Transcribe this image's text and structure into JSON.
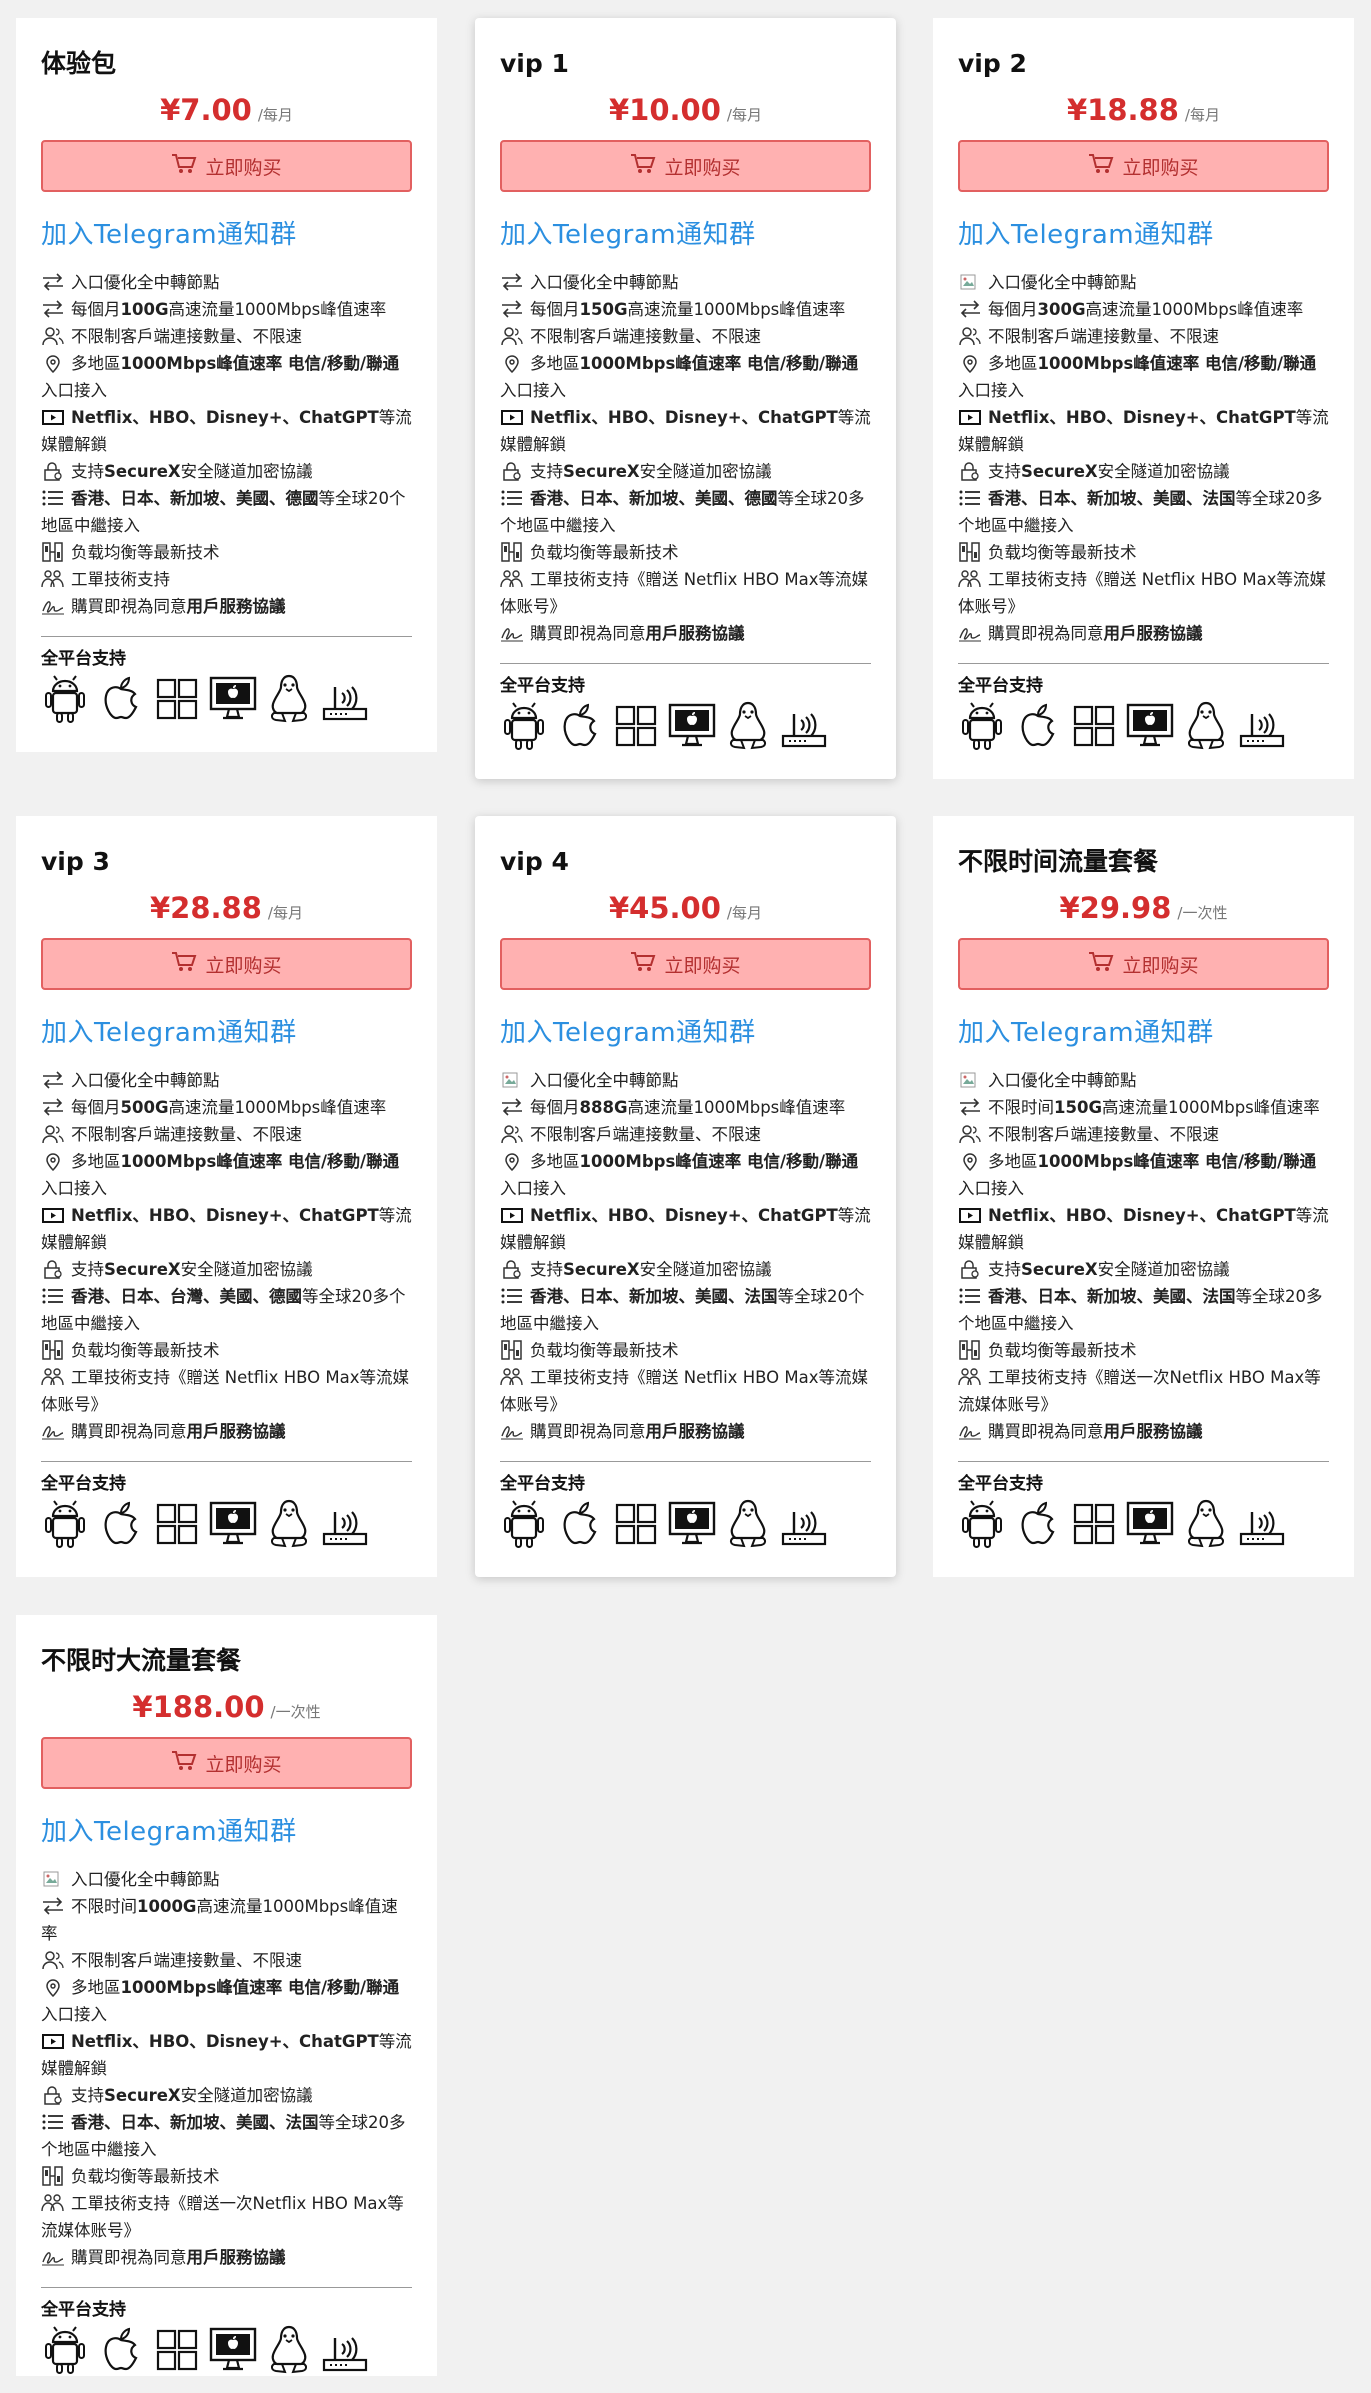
{
  "common": {
    "buy_label": "立即购买",
    "telegram_label": "加入Telegram通知群",
    "platform_title": "全平台支持",
    "platform_icons": [
      "android-icon",
      "apple-icon",
      "windows-icon",
      "mac-desktop-icon",
      "linux-icon",
      "router-icon"
    ]
  },
  "colors": {
    "price": "#d42e2e",
    "button_bg": "#ffb1b1",
    "button_border": "#e26060",
    "telegram_link": "#2b8fe0"
  },
  "plans": [
    {
      "title": "体验包",
      "price": "¥7.00",
      "period": "/每月",
      "features": [
        {
          "icon": "switch-icon",
          "parts": [
            {
              "t": "入口優化全中轉節點"
            }
          ]
        },
        {
          "icon": "switch-icon",
          "parts": [
            {
              "t": "每個月"
            },
            {
              "t": "100G",
              "b": true
            },
            {
              "t": "高速流量1000Mbps峰值速率"
            }
          ]
        },
        {
          "icon": "users-icon",
          "parts": [
            {
              "t": "不限制客戶端連接數量、不限速"
            }
          ]
        },
        {
          "icon": "location-icon",
          "parts": [
            {
              "t": "多地區"
            },
            {
              "t": "1000Mbps峰值速率 电信/移動/聯通",
              "b": true
            },
            {
              "t": "入口接入"
            }
          ]
        },
        {
          "icon": "video-icon",
          "parts": [
            {
              "t": "Netflix、HBO、Disney+、ChatGPT",
              "b": true
            },
            {
              "t": "等流媒體解鎖"
            }
          ]
        },
        {
          "icon": "lock-icon",
          "parts": [
            {
              "t": "支持"
            },
            {
              "t": "SecureX",
              "b": true
            },
            {
              "t": "安全隧道加密協議"
            }
          ]
        },
        {
          "icon": "list-icon",
          "parts": [
            {
              "t": "香港、日本、新加坡、美國、德國",
              "b": true
            },
            {
              "t": "等全球20个地區中繼接入"
            }
          ]
        },
        {
          "icon": "balance-icon",
          "parts": [
            {
              "t": "负载均衡等最新技术"
            }
          ]
        },
        {
          "icon": "support-icon",
          "parts": [
            {
              "t": "工單技術支持"
            }
          ]
        },
        {
          "icon": "sign-icon",
          "parts": [
            {
              "t": "購買即視為同意"
            },
            {
              "t": "用戶服務協議",
              "b": true
            }
          ]
        }
      ]
    },
    {
      "title": "vip 1",
      "price": "¥10.00",
      "period": "/每月",
      "features": [
        {
          "icon": "switch-icon",
          "parts": [
            {
              "t": "入口優化全中轉節點"
            }
          ]
        },
        {
          "icon": "switch-icon",
          "parts": [
            {
              "t": "每個月"
            },
            {
              "t": "150G",
              "b": true
            },
            {
              "t": "高速流量1000Mbps峰值速率"
            }
          ]
        },
        {
          "icon": "users-icon",
          "parts": [
            {
              "t": "不限制客戶端連接數量、不限速"
            }
          ]
        },
        {
          "icon": "location-icon",
          "parts": [
            {
              "t": "多地區"
            },
            {
              "t": "1000Mbps峰值速率 电信/移動/聯通",
              "b": true
            },
            {
              "t": "入口接入"
            }
          ]
        },
        {
          "icon": "video-icon",
          "parts": [
            {
              "t": "Netflix、HBO、Disney+、ChatGPT",
              "b": true
            },
            {
              "t": "等流媒體解鎖"
            }
          ]
        },
        {
          "icon": "lock-icon",
          "parts": [
            {
              "t": "支持"
            },
            {
              "t": "SecureX",
              "b": true
            },
            {
              "t": "安全隧道加密協議"
            }
          ]
        },
        {
          "icon": "list-icon",
          "parts": [
            {
              "t": "香港、日本、新加坡、美國、德國",
              "b": true
            },
            {
              "t": "等全球20多个地區中繼接入"
            }
          ]
        },
        {
          "icon": "balance-icon",
          "parts": [
            {
              "t": "负载均衡等最新技术"
            }
          ]
        },
        {
          "icon": "support-icon",
          "parts": [
            {
              "t": "工單技術支持《贈送 Netflix HBO Max等流媒体账号》"
            }
          ]
        },
        {
          "icon": "sign-icon",
          "parts": [
            {
              "t": "購買即視為同意"
            },
            {
              "t": "用戶服務協議",
              "b": true
            }
          ]
        }
      ]
    },
    {
      "title": "vip 2",
      "price": "¥18.88",
      "period": "/每月",
      "features": [
        {
          "icon": "broken-image-icon",
          "parts": [
            {
              "t": "入口優化全中轉節點"
            }
          ]
        },
        {
          "icon": "switch-icon",
          "parts": [
            {
              "t": "每個月"
            },
            {
              "t": "300G",
              "b": true
            },
            {
              "t": "高速流量1000Mbps峰值速率"
            }
          ]
        },
        {
          "icon": "users-icon",
          "parts": [
            {
              "t": "不限制客戶端連接數量、不限速"
            }
          ]
        },
        {
          "icon": "location-icon",
          "parts": [
            {
              "t": "多地區"
            },
            {
              "t": "1000Mbps峰值速率 电信/移動/聯通",
              "b": true
            },
            {
              "t": "入口接入"
            }
          ]
        },
        {
          "icon": "video-icon",
          "parts": [
            {
              "t": "Netflix、HBO、Disney+、ChatGPT",
              "b": true
            },
            {
              "t": "等流媒體解鎖"
            }
          ]
        },
        {
          "icon": "lock-icon",
          "parts": [
            {
              "t": "支持"
            },
            {
              "t": "SecureX",
              "b": true
            },
            {
              "t": "安全隧道加密協議"
            }
          ]
        },
        {
          "icon": "list-icon",
          "parts": [
            {
              "t": "香港、日本、新加坡、美國、法国",
              "b": true
            },
            {
              "t": "等全球20多个地區中繼接入"
            }
          ]
        },
        {
          "icon": "balance-icon",
          "parts": [
            {
              "t": "负载均衡等最新技术"
            }
          ]
        },
        {
          "icon": "support-icon",
          "parts": [
            {
              "t": "工單技術支持《贈送 Netflix HBO Max等流媒体账号》"
            }
          ]
        },
        {
          "icon": "sign-icon",
          "parts": [
            {
              "t": "購買即視為同意"
            },
            {
              "t": "用戶服務協議",
              "b": true
            }
          ]
        }
      ]
    },
    {
      "title": "vip 3",
      "price": "¥28.88",
      "period": "/每月",
      "features": [
        {
          "icon": "switch-icon",
          "parts": [
            {
              "t": "入口優化全中轉節點"
            }
          ]
        },
        {
          "icon": "switch-icon",
          "parts": [
            {
              "t": "每個月"
            },
            {
              "t": "500G",
              "b": true
            },
            {
              "t": "高速流量1000Mbps峰值速率"
            }
          ]
        },
        {
          "icon": "users-icon",
          "parts": [
            {
              "t": "不限制客戶端連接數量、不限速"
            }
          ]
        },
        {
          "icon": "location-icon",
          "parts": [
            {
              "t": "多地區"
            },
            {
              "t": "1000Mbps峰值速率 电信/移動/聯通",
              "b": true
            },
            {
              "t": "入口接入"
            }
          ]
        },
        {
          "icon": "video-icon",
          "parts": [
            {
              "t": "Netflix、HBO、Disney+、ChatGPT",
              "b": true
            },
            {
              "t": "等流媒體解鎖"
            }
          ]
        },
        {
          "icon": "lock-icon",
          "parts": [
            {
              "t": "支持"
            },
            {
              "t": "SecureX",
              "b": true
            },
            {
              "t": "安全隧道加密協議"
            }
          ]
        },
        {
          "icon": "list-icon",
          "parts": [
            {
              "t": "香港、日本、台灣、美國、德國",
              "b": true
            },
            {
              "t": "等全球20多个地區中繼接入"
            }
          ]
        },
        {
          "icon": "balance-icon",
          "parts": [
            {
              "t": "负载均衡等最新技术"
            }
          ]
        },
        {
          "icon": "support-icon",
          "parts": [
            {
              "t": "工單技術支持《贈送 Netflix HBO Max等流媒体账号》"
            }
          ]
        },
        {
          "icon": "sign-icon",
          "parts": [
            {
              "t": "購買即視為同意"
            },
            {
              "t": "用戶服務協議",
              "b": true
            }
          ]
        }
      ]
    },
    {
      "title": "vip 4",
      "price": "¥45.00",
      "period": "/每月",
      "features": [
        {
          "icon": "broken-image-icon",
          "parts": [
            {
              "t": "入口優化全中轉節點"
            }
          ]
        },
        {
          "icon": "switch-icon",
          "parts": [
            {
              "t": "每個月"
            },
            {
              "t": "888G",
              "b": true
            },
            {
              "t": "高速流量1000Mbps峰值速率"
            }
          ]
        },
        {
          "icon": "users-icon",
          "parts": [
            {
              "t": "不限制客戶端連接數量、不限速"
            }
          ]
        },
        {
          "icon": "location-icon",
          "parts": [
            {
              "t": "多地區"
            },
            {
              "t": "1000Mbps峰值速率 电信/移動/聯通",
              "b": true
            },
            {
              "t": "入口接入"
            }
          ]
        },
        {
          "icon": "video-icon",
          "parts": [
            {
              "t": "Netflix、HBO、Disney+、ChatGPT",
              "b": true
            },
            {
              "t": "等流媒體解鎖"
            }
          ]
        },
        {
          "icon": "lock-icon",
          "parts": [
            {
              "t": "支持"
            },
            {
              "t": "SecureX",
              "b": true
            },
            {
              "t": "安全隧道加密協議"
            }
          ]
        },
        {
          "icon": "list-icon",
          "parts": [
            {
              "t": "香港、日本、新加坡、美國、法国",
              "b": true
            },
            {
              "t": "等全球20个地區中繼接入"
            }
          ]
        },
        {
          "icon": "balance-icon",
          "parts": [
            {
              "t": "负载均衡等最新技术"
            }
          ]
        },
        {
          "icon": "support-icon",
          "parts": [
            {
              "t": "工單技術支持《贈送 Netflix HBO Max等流媒体账号》"
            }
          ]
        },
        {
          "icon": "sign-icon",
          "parts": [
            {
              "t": "購買即視為同意"
            },
            {
              "t": "用戶服務協議",
              "b": true
            }
          ]
        }
      ]
    },
    {
      "title": "不限时间流量套餐",
      "price": "¥29.98",
      "period": "/一次性",
      "features": [
        {
          "icon": "broken-image-icon",
          "parts": [
            {
              "t": "入口優化全中轉節點"
            }
          ]
        },
        {
          "icon": "switch-icon",
          "parts": [
            {
              "t": "不限时间"
            },
            {
              "t": "150G",
              "b": true
            },
            {
              "t": "高速流量1000Mbps峰值速率"
            }
          ]
        },
        {
          "icon": "users-icon",
          "parts": [
            {
              "t": "不限制客戶端連接數量、不限速"
            }
          ]
        },
        {
          "icon": "location-icon",
          "parts": [
            {
              "t": "多地區"
            },
            {
              "t": "1000Mbps峰值速率 电信/移動/聯通",
              "b": true
            },
            {
              "t": "入口接入"
            }
          ]
        },
        {
          "icon": "video-icon",
          "parts": [
            {
              "t": "Netflix、HBO、Disney+、ChatGPT",
              "b": true
            },
            {
              "t": "等流媒體解鎖"
            }
          ]
        },
        {
          "icon": "lock-icon",
          "parts": [
            {
              "t": "支持"
            },
            {
              "t": "SecureX",
              "b": true
            },
            {
              "t": "安全隧道加密協議"
            }
          ]
        },
        {
          "icon": "list-icon",
          "parts": [
            {
              "t": "香港、日本、新加坡、美國、法国",
              "b": true
            },
            {
              "t": "等全球20多个地區中繼接入"
            }
          ]
        },
        {
          "icon": "balance-icon",
          "parts": [
            {
              "t": "负载均衡等最新技术"
            }
          ]
        },
        {
          "icon": "support-icon",
          "parts": [
            {
              "t": "工單技術支持《贈送一次Netflix HBO Max等流媒体账号》"
            }
          ]
        },
        {
          "icon": "sign-icon",
          "parts": [
            {
              "t": "購買即視為同意"
            },
            {
              "t": "用戶服務協議",
              "b": true
            }
          ]
        }
      ]
    },
    {
      "title": "不限时大流量套餐",
      "price": "¥188.00",
      "period": "/一次性",
      "features": [
        {
          "icon": "broken-image-icon",
          "parts": [
            {
              "t": "入口優化全中轉節點"
            }
          ]
        },
        {
          "icon": "switch-icon",
          "parts": [
            {
              "t": "不限时间"
            },
            {
              "t": "1000G",
              "b": true
            },
            {
              "t": "高速流量1000Mbps峰值速率"
            }
          ]
        },
        {
          "icon": "users-icon",
          "parts": [
            {
              "t": "不限制客戶端連接數量、不限速"
            }
          ]
        },
        {
          "icon": "location-icon",
          "parts": [
            {
              "t": "多地區"
            },
            {
              "t": "1000Mbps峰值速率 电信/移動/聯通",
              "b": true
            },
            {
              "t": "入口接入"
            }
          ]
        },
        {
          "icon": "video-icon",
          "parts": [
            {
              "t": "Netflix、HBO、Disney+、ChatGPT",
              "b": true
            },
            {
              "t": "等流媒體解鎖"
            }
          ]
        },
        {
          "icon": "lock-icon",
          "parts": [
            {
              "t": "支持"
            },
            {
              "t": "SecureX",
              "b": true
            },
            {
              "t": "安全隧道加密協議"
            }
          ]
        },
        {
          "icon": "list-icon",
          "parts": [
            {
              "t": "香港、日本、新加坡、美國、法国",
              "b": true
            },
            {
              "t": "等全球20多个地區中繼接入"
            }
          ]
        },
        {
          "icon": "balance-icon",
          "parts": [
            {
              "t": "负载均衡等最新技术"
            }
          ]
        },
        {
          "icon": "support-icon",
          "parts": [
            {
              "t": "工單技術支持《贈送一次Netflix HBO Max等流媒体账号》"
            }
          ]
        },
        {
          "icon": "sign-icon",
          "parts": [
            {
              "t": "購買即視為同意"
            },
            {
              "t": "用戶服務協議",
              "b": true
            }
          ]
        }
      ]
    }
  ]
}
